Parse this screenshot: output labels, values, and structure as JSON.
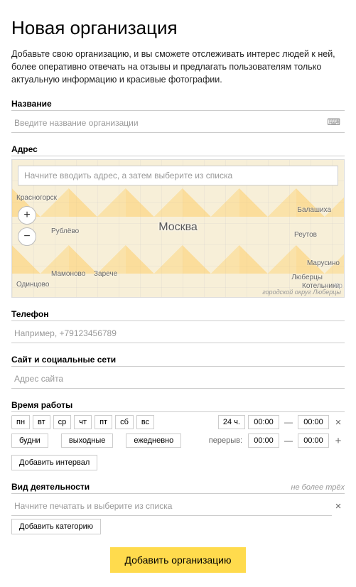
{
  "title": "Новая организация",
  "description": "Добавьте свою организацию, и вы сможете отслеживать интерес людей к ней, более оперативно отвечать на отзывы и предлагать пользователям только актуальную информацию и красивые фотографии.",
  "name_section": {
    "label": "Название",
    "placeholder": "Введите название организации"
  },
  "address_section": {
    "label": "Адрес",
    "search_placeholder": "Начните вводить адрес, а затем выберите из списка",
    "center_city": "Москва",
    "labels": [
      "Красногорск",
      "Рублёво",
      "Одинцово",
      "Мамоново",
      "Зарече",
      "Балашиха",
      "Реутов",
      "Люберцы",
      "Котельники",
      "Марусино",
      "Кр"
    ],
    "credit": "городской округ Люберцы"
  },
  "phone_section": {
    "label": "Телефон",
    "placeholder": "Например, +79123456789"
  },
  "site_section": {
    "label": "Сайт и социальные сети",
    "placeholder": "Адрес сайта"
  },
  "hours_section": {
    "label": "Время работы",
    "days": [
      "пн",
      "вт",
      "ср",
      "чт",
      "пт",
      "сб",
      "вс"
    ],
    "allday": "24 ч.",
    "time_from": "00:00",
    "time_to": "00:00",
    "presets": {
      "weekdays": "будни",
      "weekend": "выходные",
      "daily": "ежедневно"
    },
    "break_label": "перерыв:",
    "break_from": "00:00",
    "break_to": "00:00",
    "add_interval": "Добавить интервал"
  },
  "category_section": {
    "label": "Вид деятельности",
    "hint": "не более трёх",
    "placeholder": "Начните печатать и выберите из списка",
    "add_category": "Добавить категорию"
  },
  "submit_label": "Добавить организацию"
}
